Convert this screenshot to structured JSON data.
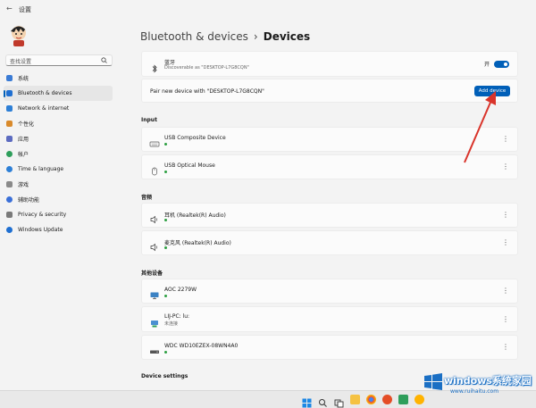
{
  "window": {
    "title": "设置",
    "back_glyph": "←"
  },
  "search": {
    "placeholder": "查找设置"
  },
  "sidebar": {
    "items": [
      {
        "label": "系统",
        "color": "#3a7bd5"
      },
      {
        "label": "Bluetooth & devices",
        "color": "#1f6fd1",
        "active": true
      },
      {
        "label": "Network & internet",
        "color": "#2d7fd6"
      },
      {
        "label": "个性化",
        "color": "#d98a2b"
      },
      {
        "label": "应用",
        "color": "#5c6bc0"
      },
      {
        "label": "帐户",
        "color": "#2e9e5b"
      },
      {
        "label": "Time & language",
        "color": "#2d7fd6"
      },
      {
        "label": "游戏",
        "color": "#8a8a8a"
      },
      {
        "label": "辅助功能",
        "color": "#3a6fd8"
      },
      {
        "label": "Privacy & security",
        "color": "#7a7a7a"
      },
      {
        "label": "Windows Update",
        "color": "#1f6fd1"
      }
    ]
  },
  "breadcrumb": {
    "parent": "Bluetooth & devices",
    "separator": "›",
    "current": "Devices"
  },
  "bluetooth": {
    "name": "蓝牙",
    "status": "Discoverable as \"DESKTOP-L7G8CQN\"",
    "toggle_label": "开",
    "toggle_on": true
  },
  "pair": {
    "text": "Pair new device with \"DESKTOP-L7G8CQN\"",
    "button": "Add device"
  },
  "sections": {
    "input": "Input",
    "audio": "音频",
    "other": "其他设备",
    "settings": "Device settings"
  },
  "devices": {
    "input": [
      {
        "name": "USB Composite Device",
        "icon": "keyboard-icon"
      },
      {
        "name": "USB Optical Mouse",
        "icon": "mouse-icon"
      }
    ],
    "audio": [
      {
        "name": "耳机 (Realtek(R) Audio)",
        "icon": "speaker-icon"
      },
      {
        "name": "麦克风 (Realtek(R) Audio)",
        "icon": "speaker-icon"
      }
    ],
    "other": [
      {
        "name": "AOC 2279W",
        "icon": "monitor-icon",
        "sub": ""
      },
      {
        "name": "LIJ-PC: lu:",
        "icon": "computer-icon",
        "sub": "未连接"
      },
      {
        "name": "WDC WD10EZEX-08WN4A0",
        "icon": "drive-icon",
        "sub": ""
      }
    ]
  },
  "more_glyph": "⋮",
  "watermark": {
    "line1": "windows系统家园",
    "line2": "www.ruihaitu.com"
  },
  "accent": "#005fb8"
}
